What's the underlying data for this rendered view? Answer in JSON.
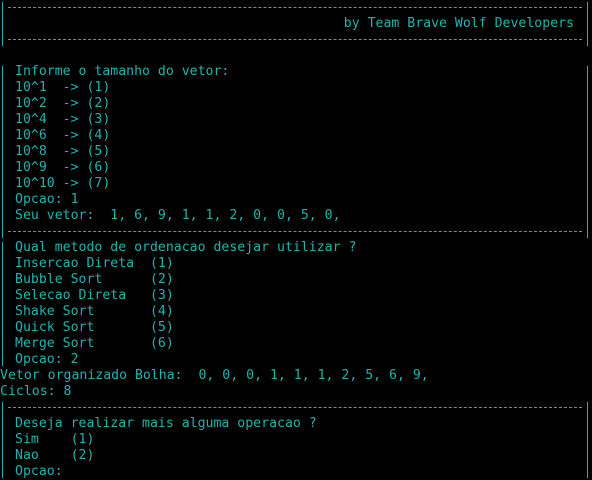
{
  "theme": {
    "foreground": "#1cb5b0",
    "background": "#000000"
  },
  "header": {
    "credit": "by Team Brave Wolf Developers"
  },
  "size_menu": {
    "prompt": "Informe o tamanho do vetor:",
    "options": [
      "10^1  -> (1)",
      "10^2  -> (2)",
      "10^4  -> (3)",
      "10^6  -> (4)",
      "10^8  -> (5)",
      "10^9  -> (6)",
      "10^10 -> (7)"
    ],
    "choice": "Opcao: 1",
    "vector": "Seu vetor:  1, 6, 9, 1, 1, 2, 0, 0, 5, 0,"
  },
  "sort_menu": {
    "prompt": "Qual metodo de ordenacao desejar utilizar ?",
    "options": [
      "Insercao Direta  (1)",
      "Bubble Sort      (2)",
      "Selecao Direta   (3)",
      "Shake Sort       (4)",
      "Quick Sort       (5)",
      "Merge Sort       (6)"
    ],
    "choice": "Opcao: 2"
  },
  "result": {
    "sorted": "Vetor organizado Bolha:  0, 0, 0, 1, 1, 1, 2, 5, 6, 9,",
    "cycles": "Ciclos: 8"
  },
  "again_menu": {
    "prompt": "Deseja realizar mais alguma operacao ?",
    "options": [
      "Sim    (1)",
      "Nao    (2)"
    ],
    "input_label": "Opcao:",
    "input_value": ""
  }
}
